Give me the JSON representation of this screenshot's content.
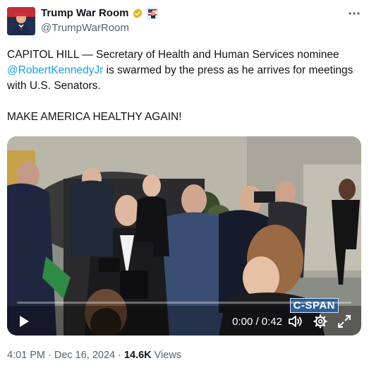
{
  "author": {
    "display_name": "Trump War Room",
    "handle": "@TrumpWarRoom",
    "avatar_icon": "avatar-icon",
    "verified_color": "#e8b21c"
  },
  "tweet": {
    "text_before": "CAPITOL HILL — Secretary of Health and Human Services nominee ",
    "mention": "@RobertKennedyJr",
    "text_after": " is swarmed by the press as he arrives for meetings with U.S. Senators.\n\nMAKE AMERICA HEALTHY AGAIN!"
  },
  "video": {
    "watermark": "C-SPAN",
    "time": "0:00 / 0:42",
    "progress": 0
  },
  "meta": {
    "time": "4:01 PM",
    "separator": "·",
    "date": "Dec 16, 2024",
    "views_count": "14.6K",
    "views_label": "Views"
  },
  "colors": {
    "link": "#1d9bf0",
    "muted": "#536471",
    "text": "#0f1419"
  }
}
